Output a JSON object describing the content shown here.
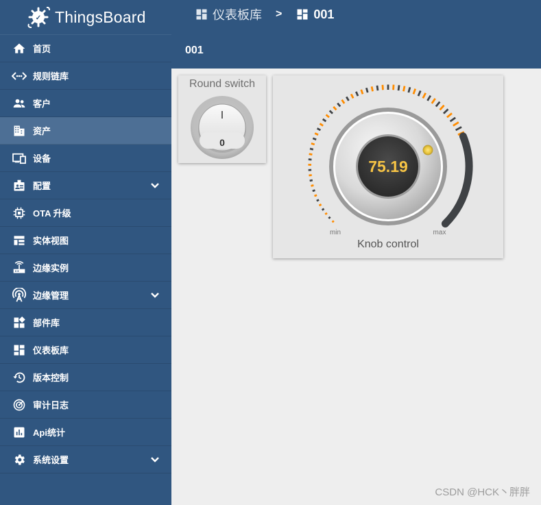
{
  "brand": {
    "name": "ThingsBoard"
  },
  "breadcrumb": {
    "section": "仪表板库",
    "separator": ">",
    "current": "001"
  },
  "dashboard": {
    "title": "001"
  },
  "sidebar": {
    "items": [
      {
        "label": "首页",
        "icon": "home-icon"
      },
      {
        "label": "规则链库",
        "icon": "rule-chain-icon"
      },
      {
        "label": "客户",
        "icon": "customers-icon"
      },
      {
        "label": "资产",
        "icon": "assets-icon"
      },
      {
        "label": "设备",
        "icon": "devices-icon"
      },
      {
        "label": "配置",
        "icon": "profiles-icon"
      },
      {
        "label": "OTA 升级",
        "icon": "chip-icon"
      },
      {
        "label": "实体视图",
        "icon": "entity-view-icon"
      },
      {
        "label": "边缘实例",
        "icon": "router-icon"
      },
      {
        "label": "边缘管理",
        "icon": "antenna-icon"
      },
      {
        "label": "部件库",
        "icon": "widgets-icon"
      },
      {
        "label": "仪表板库",
        "icon": "dashboard-icon"
      },
      {
        "label": "版本控制",
        "icon": "history-icon"
      },
      {
        "label": "审计日志",
        "icon": "track-changes-icon"
      },
      {
        "label": "Api统计",
        "icon": "stats-icon"
      },
      {
        "label": "系统设置",
        "icon": "settings-icon"
      }
    ],
    "active": "资产"
  },
  "widgets": {
    "round_switch": {
      "title": "Round switch",
      "on_label": "I",
      "off_label": "0"
    },
    "knob": {
      "title": "Knob control",
      "value": "75.19",
      "min_label": "min",
      "max_label": "max",
      "value_fraction": 0.7519
    }
  },
  "colors": {
    "sidebar": "#305680",
    "active_item": "#4d6f95",
    "accent": "#ff8c00",
    "value": "#f7c445"
  },
  "watermark": "CSDN @HCK丶胖胖"
}
